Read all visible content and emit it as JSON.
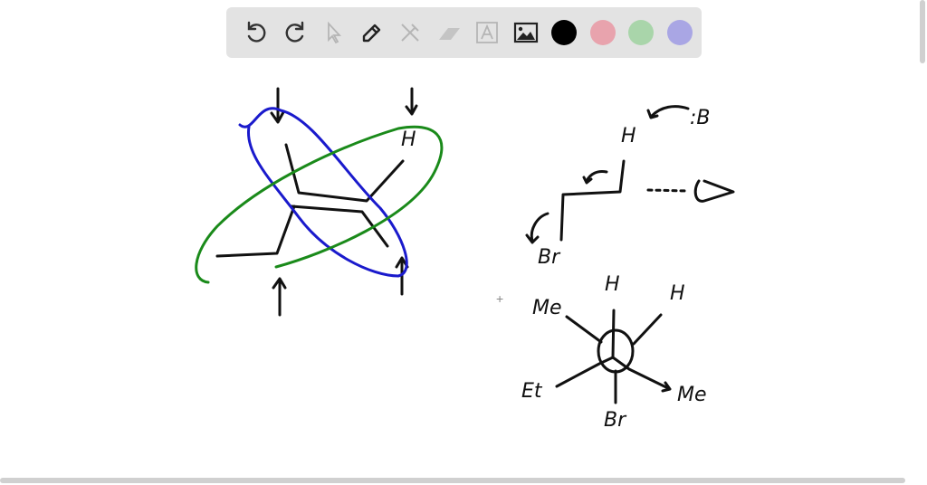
{
  "toolbar": {
    "tools": [
      "undo",
      "redo",
      "select",
      "pen",
      "tools",
      "eraser",
      "text",
      "image"
    ],
    "colors": [
      "#000000",
      "#e8a3ad",
      "#a9d5aa",
      "#a9a6e4"
    ],
    "selected_color": "#000000"
  },
  "drawing": {
    "labels": {
      "h_top": "H",
      "b_base": ":B",
      "h_e2": "H",
      "br_e2": "Br",
      "newman_h1": "H",
      "newman_h2": "H",
      "newman_me1": "Me",
      "newman_et": "Et",
      "newman_me2": "Me",
      "newman_br": "Br"
    },
    "stroke_colors": {
      "ink": "#111111",
      "blue": "#1a1acc",
      "green": "#1a8a1a"
    }
  }
}
